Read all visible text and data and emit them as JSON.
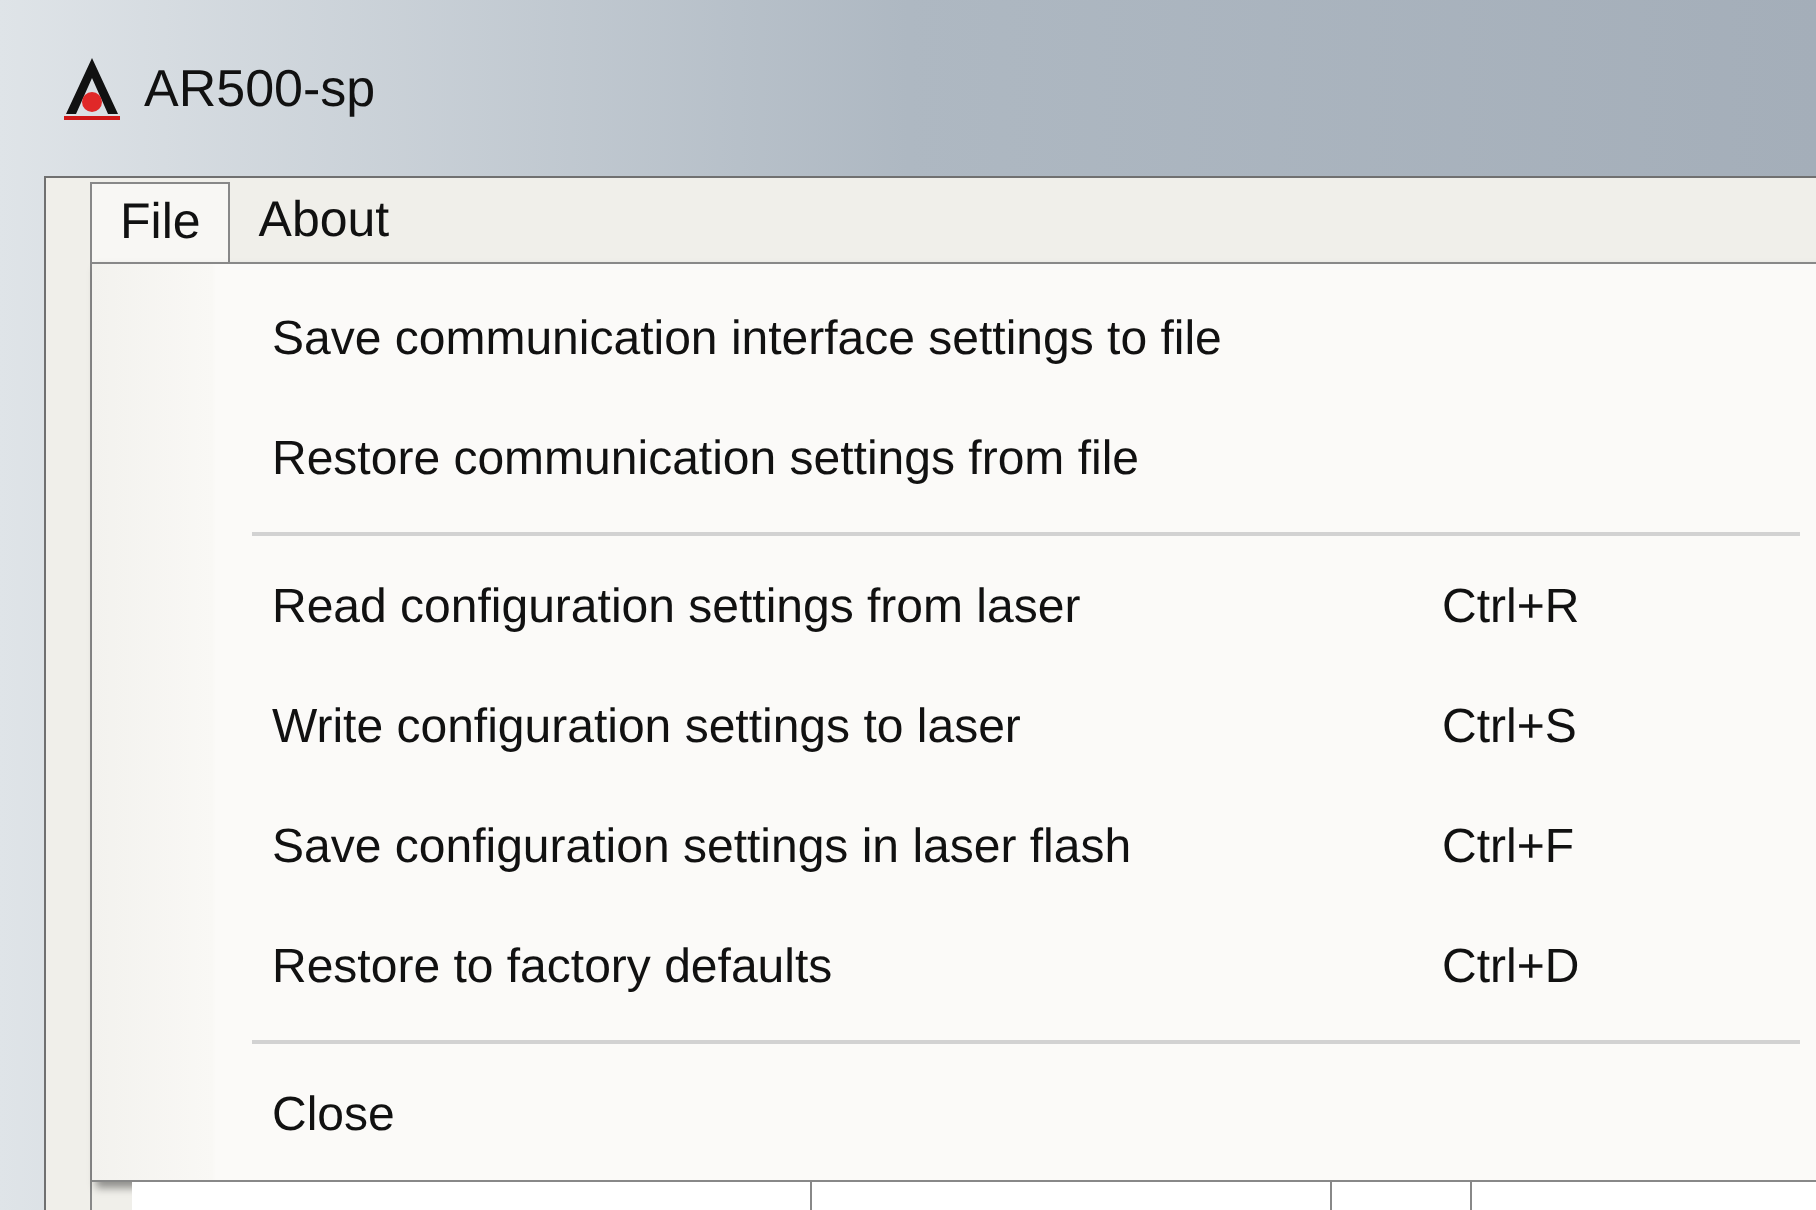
{
  "window": {
    "title": "AR500-sp"
  },
  "menu_bar": [
    {
      "label": "File",
      "selected": true
    },
    {
      "label": "About",
      "selected": false
    }
  ],
  "file_menu": [
    {
      "kind": "item",
      "label": "Save communication interface settings to file"
    },
    {
      "kind": "item",
      "label": "Restore communication settings from file"
    },
    {
      "kind": "separator"
    },
    {
      "kind": "item",
      "label": "Read configuration settings from laser",
      "shortcut": "Ctrl+R"
    },
    {
      "kind": "item",
      "label": "Write configuration settings to laser",
      "shortcut": "Ctrl+S"
    },
    {
      "kind": "item",
      "label": "Save configuration settings in laser flash",
      "shortcut": "Ctrl+F"
    },
    {
      "kind": "item",
      "label": "Restore to factory defaults",
      "shortcut": "Ctrl+D"
    },
    {
      "kind": "separator"
    },
    {
      "kind": "item",
      "label": "Close"
    }
  ]
}
